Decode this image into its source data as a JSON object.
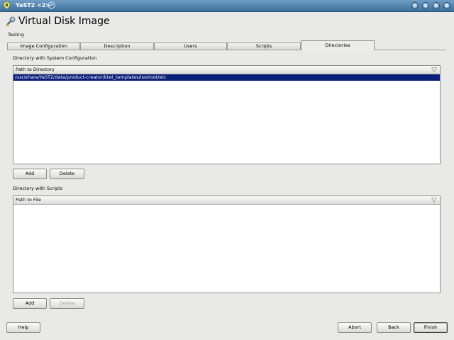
{
  "window": {
    "title": "YaST2 <2>",
    "icons": {
      "app": "yast-shield-icon",
      "pin": "pin-icon"
    },
    "controls": [
      "help-icon",
      "minimize-icon",
      "maximize-icon",
      "close-icon"
    ]
  },
  "header": {
    "icon": "wrench-icon",
    "title": "Virtual Disk Image",
    "subtitle": "Testing"
  },
  "tabs": [
    {
      "label": "Image Configuration",
      "active": false
    },
    {
      "label": "Description",
      "active": false
    },
    {
      "label": "Users",
      "active": false
    },
    {
      "label": "Scripts",
      "active": false
    },
    {
      "label": "Directories",
      "active": true
    }
  ],
  "system_config": {
    "section_label": "Directory with System Configuration",
    "column_header": "Path to Directory",
    "rows": [
      {
        "value": "/usr/share/YaST2/data/product-creator/kiwi_templates/iso/root/etc",
        "selected": true
      }
    ],
    "add_label": "Add",
    "delete_label": "Delete",
    "delete_enabled": true
  },
  "scripts": {
    "section_label": "Directory with Scripts",
    "column_header": "Path to File",
    "rows": [],
    "add_label": "Add",
    "delete_label": "Delete",
    "delete_enabled": false
  },
  "footer": {
    "help_label": "Help",
    "abort_label": "Abort",
    "back_label": "Back",
    "finish_label": "Finish"
  },
  "colors": {
    "titlebar": "#4a7aa6",
    "selection": "#0a1f7a",
    "background": "#e9e9e8"
  }
}
